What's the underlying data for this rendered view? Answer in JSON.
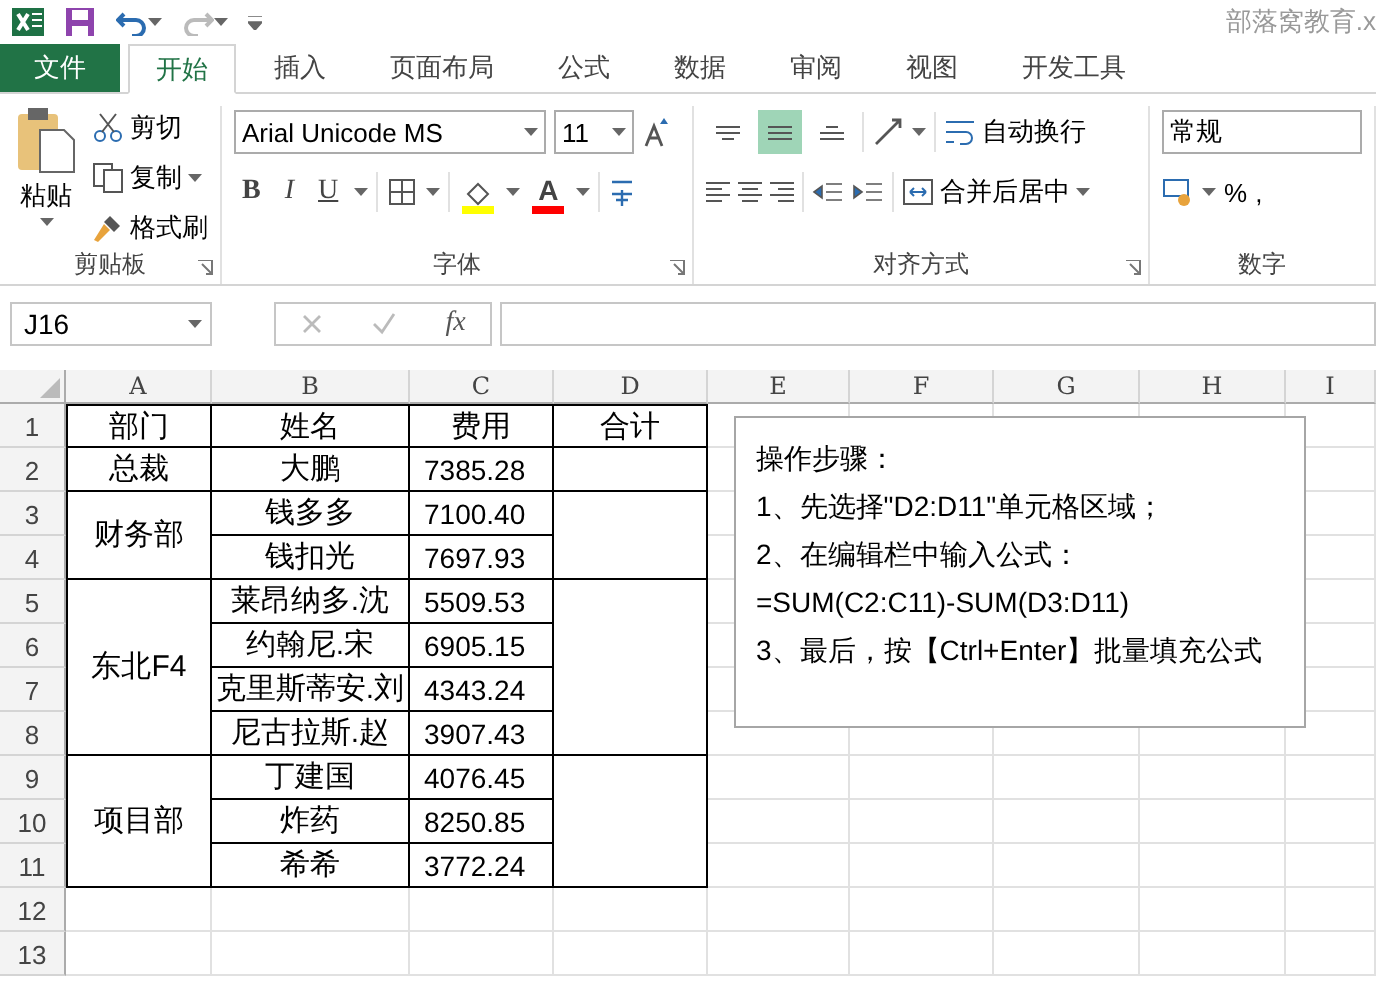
{
  "window": {
    "title": "部落窝教育.x"
  },
  "tabs": [
    {
      "label": "文件",
      "kind": "file",
      "selected": false
    },
    {
      "label": "开始",
      "kind": "tab",
      "selected": true
    },
    {
      "label": "插入",
      "kind": "tab",
      "selected": false
    },
    {
      "label": "页面布局",
      "kind": "tab",
      "selected": false
    },
    {
      "label": "公式",
      "kind": "tab",
      "selected": false
    },
    {
      "label": "数据",
      "kind": "tab",
      "selected": false
    },
    {
      "label": "审阅",
      "kind": "tab",
      "selected": false
    },
    {
      "label": "视图",
      "kind": "tab",
      "selected": false
    },
    {
      "label": "开发工具",
      "kind": "tab",
      "selected": false
    }
  ],
  "ribbon": {
    "clipboard": {
      "paste": "粘贴",
      "cut": "剪切",
      "copy": "复制",
      "format_painter": "格式刷",
      "label": "剪贴板"
    },
    "font": {
      "family": "Arial Unicode MS",
      "size": "11",
      "bold": "B",
      "italic": "I",
      "underline": "U",
      "font_color_glyph": "A",
      "label": "字体"
    },
    "alignment": {
      "vertical": [
        {
          "kind": "top",
          "selected": false
        },
        {
          "kind": "middle",
          "selected": true
        },
        {
          "kind": "bottom",
          "selected": false
        }
      ],
      "wrap_text": "自动换行",
      "merge_center": "合并后居中",
      "label": "对齐方式"
    },
    "number": {
      "format": "常规",
      "percent": "%",
      "comma": ",",
      "label": "数字"
    }
  },
  "formula_bar": {
    "name_box": "J16",
    "function_button": "fx"
  },
  "sheet": {
    "columns": [
      "A",
      "B",
      "C",
      "D",
      "E",
      "F",
      "G",
      "H",
      "I"
    ],
    "rows": [
      "1",
      "2",
      "3",
      "4",
      "5",
      "6",
      "7",
      "8",
      "9",
      "10",
      "11",
      "12",
      "13"
    ],
    "header": [
      "部门",
      "姓名",
      "费用",
      "合计"
    ],
    "groups": [
      {
        "department": "总裁",
        "members": [
          {
            "name": "大鹏",
            "fee": "7385.28"
          }
        ]
      },
      {
        "department": "财务部",
        "members": [
          {
            "name": "钱多多",
            "fee": "7100.40"
          },
          {
            "name": "钱扣光",
            "fee": "7697.93"
          }
        ]
      },
      {
        "department": "东北F4",
        "members": [
          {
            "name": "莱昂纳多.沈",
            "fee": "5509.53"
          },
          {
            "name": "约翰尼.宋",
            "fee": "6905.15"
          },
          {
            "name": "克里斯蒂安.刘",
            "fee": "4343.24"
          },
          {
            "name": "尼古拉斯.赵",
            "fee": "3907.43"
          }
        ]
      },
      {
        "department": "项目部",
        "members": [
          {
            "name": "丁建国",
            "fee": "4076.45"
          },
          {
            "name": "炸药",
            "fee": "8250.85"
          },
          {
            "name": "希希",
            "fee": "3772.24"
          }
        ]
      }
    ]
  },
  "note": {
    "lines": [
      "操作步骤：",
      "1、先选择\"D2:D11\"单元格区域；",
      "2、在编辑栏中输入公式：",
      "=SUM(C2:C11)-SUM(D3:D11)",
      "3、最后，按【Ctrl+Enter】批量填充公式"
    ]
  }
}
